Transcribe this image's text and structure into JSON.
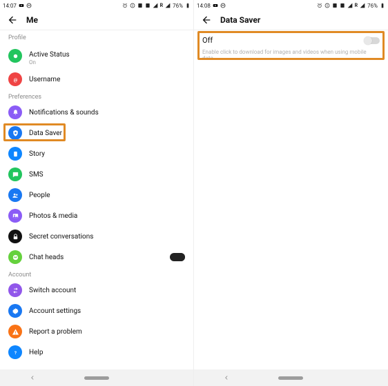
{
  "left": {
    "status": {
      "time": "14:07",
      "battery": "76%"
    },
    "title": "Me",
    "sections": {
      "profile": "Profile",
      "preferences": "Preferences",
      "account": "Account"
    },
    "items": {
      "active_status": {
        "label": "Active Status",
        "sub": "On"
      },
      "username": "Username",
      "notifications": "Notifications & sounds",
      "data_saver": "Data Saver",
      "story": "Story",
      "sms": "SMS",
      "people": "People",
      "photos": "Photos & media",
      "secret": "Secret conversations",
      "chat_heads": "Chat heads",
      "switch": "Switch account",
      "settings": "Account settings",
      "report": "Report a problem",
      "help": "Help"
    }
  },
  "right": {
    "status": {
      "time": "14:08",
      "battery": "76%"
    },
    "title": "Data Saver",
    "toggle_label": "Off",
    "hint": "Enable click to download for images and videos when using mobile data."
  },
  "icons": {
    "alarm": "⏰",
    "info": "ⓘ",
    "sim": "▭",
    "arrows": "⇅",
    "tri": "◢",
    "r": "R"
  }
}
